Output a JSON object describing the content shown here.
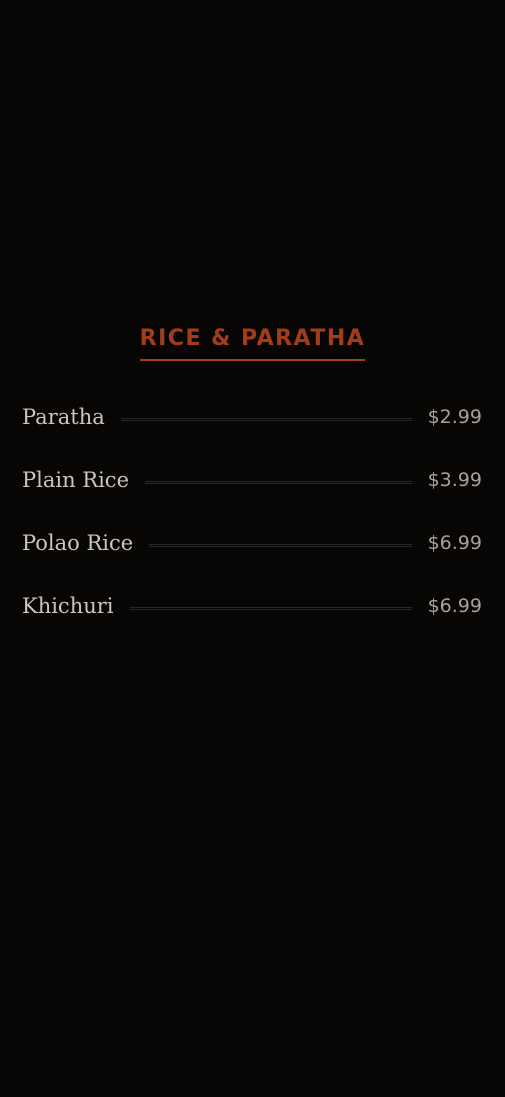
{
  "section": {
    "title": "RICE & PARATHA"
  },
  "items": [
    {
      "name": "Paratha",
      "price": "$2.99"
    },
    {
      "name": "Plain Rice",
      "price": "$3.99"
    },
    {
      "name": "Polao Rice",
      "price": "$6.99"
    },
    {
      "name": "Khichuri",
      "price": "$6.99"
    }
  ],
  "colors": {
    "background": "#080605",
    "accent": "#a23d1b",
    "item_text": "#c9c6c1",
    "price_text": "#a5a29e"
  }
}
